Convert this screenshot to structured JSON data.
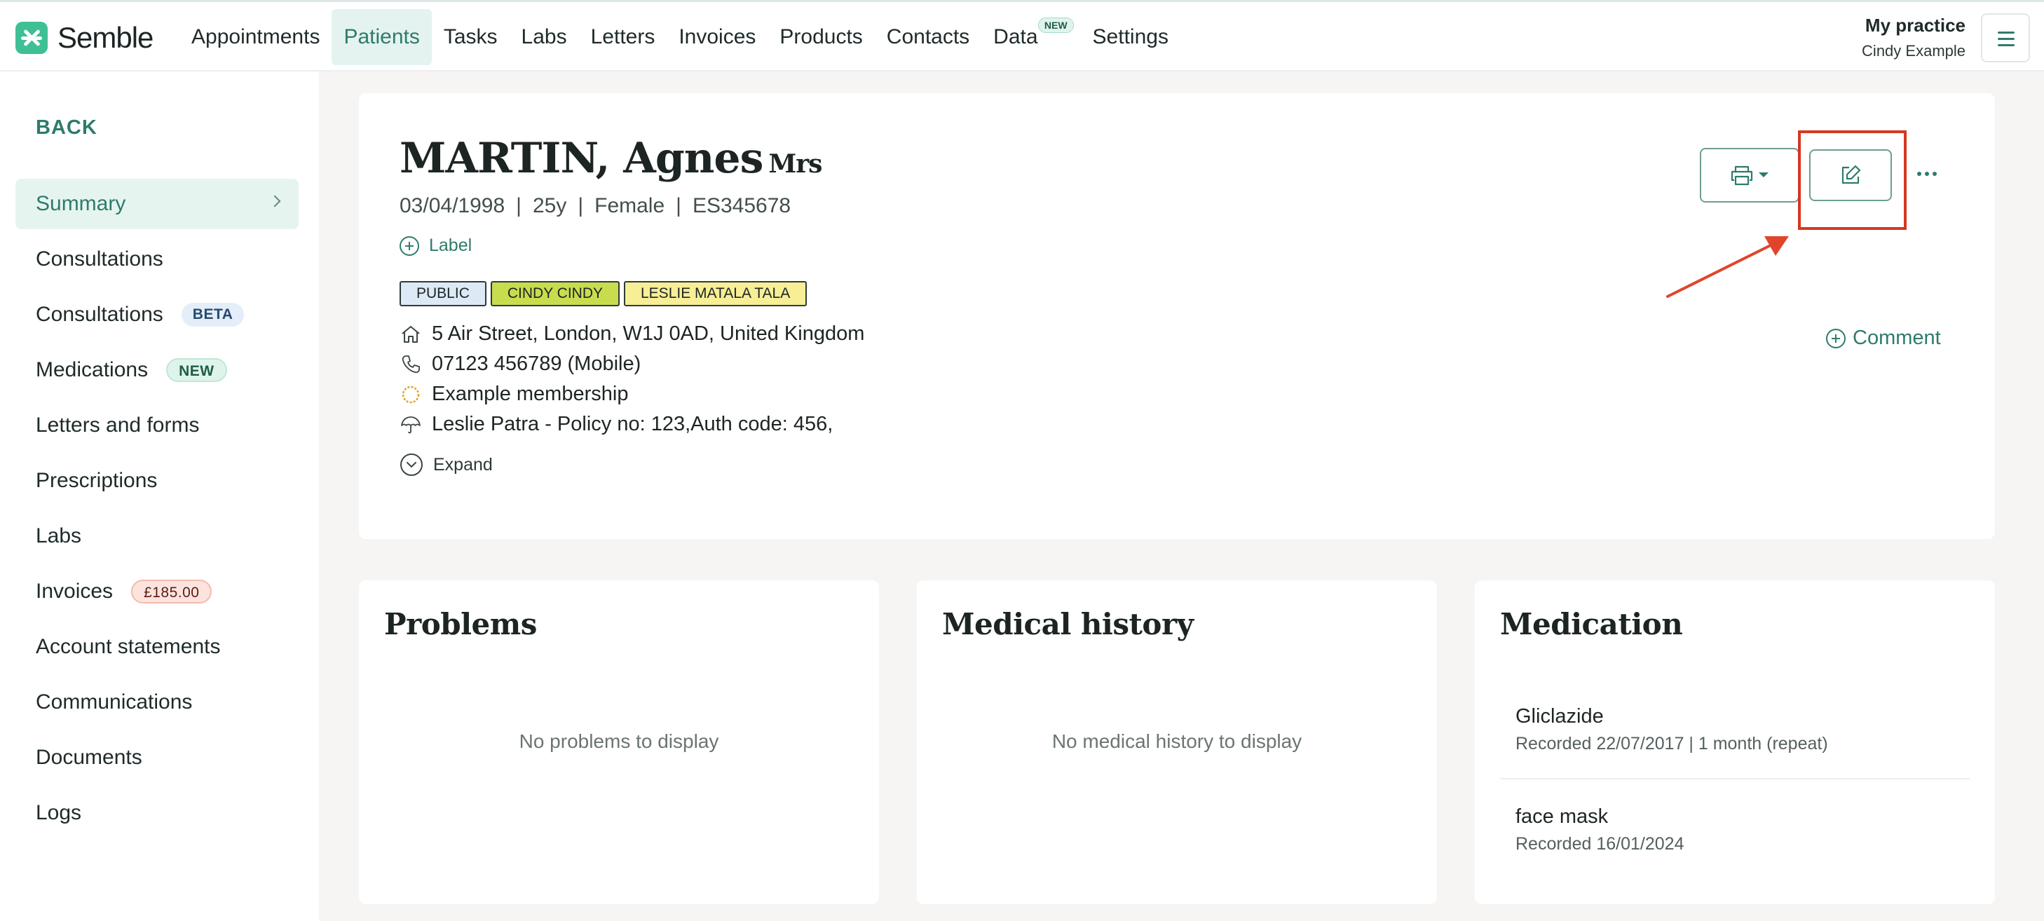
{
  "app": {
    "name": "Semble"
  },
  "nav": {
    "items": [
      {
        "label": "Appointments"
      },
      {
        "label": "Patients",
        "active": true
      },
      {
        "label": "Tasks"
      },
      {
        "label": "Labs"
      },
      {
        "label": "Letters"
      },
      {
        "label": "Invoices"
      },
      {
        "label": "Products"
      },
      {
        "label": "Contacts"
      },
      {
        "label": "Data",
        "badge": "NEW"
      },
      {
        "label": "Settings"
      }
    ]
  },
  "practice": {
    "name": "My practice",
    "user": "Cindy Example"
  },
  "sidebar": {
    "back_label": "BACK",
    "items": [
      {
        "label": "Summary",
        "active": true
      },
      {
        "label": "Consultations"
      },
      {
        "label": "Consultations",
        "badge": "BETA"
      },
      {
        "label": "Medications",
        "badge": "NEW"
      },
      {
        "label": "Letters and forms"
      },
      {
        "label": "Prescriptions"
      },
      {
        "label": "Labs"
      },
      {
        "label": "Invoices",
        "badge": "£185.00"
      },
      {
        "label": "Account statements"
      },
      {
        "label": "Communications"
      },
      {
        "label": "Documents"
      },
      {
        "label": "Logs"
      }
    ]
  },
  "patient": {
    "name": "MARTIN, Agnes",
    "title": "Mrs",
    "dob": "03/04/1998",
    "age": "25y",
    "gender": "Female",
    "id": "ES345678",
    "add_label": "Label",
    "tags": [
      {
        "label": "PUBLIC",
        "color": "#dde9f4"
      },
      {
        "label": "CINDY CINDY",
        "color": "#c9dc4e"
      },
      {
        "label": "LESLIE MATALA TALA",
        "color": "#f7ee95"
      }
    ],
    "address": "5 Air Street, London, W1J 0AD, United Kingdom",
    "phone": "07123 456789 (Mobile)",
    "membership": "Example membership",
    "insurance": "Leslie Patra - Policy no: 123,Auth code: 456,",
    "expand_label": "Expand",
    "comment_label": "Comment"
  },
  "panels": {
    "problems": {
      "title": "Problems",
      "empty": "No problems to display"
    },
    "history": {
      "title": "Medical history",
      "empty": "No medical history to display"
    },
    "medication": {
      "title": "Medication",
      "items": [
        {
          "name": "Gliclazide",
          "note": "Recorded 22/07/2017 | 1 month (repeat)"
        },
        {
          "name": "face mask",
          "note": "Recorded 16/01/2024"
        }
      ]
    }
  },
  "colors": {
    "accent": "#2e7b6c",
    "annotation": "#d6371f"
  }
}
